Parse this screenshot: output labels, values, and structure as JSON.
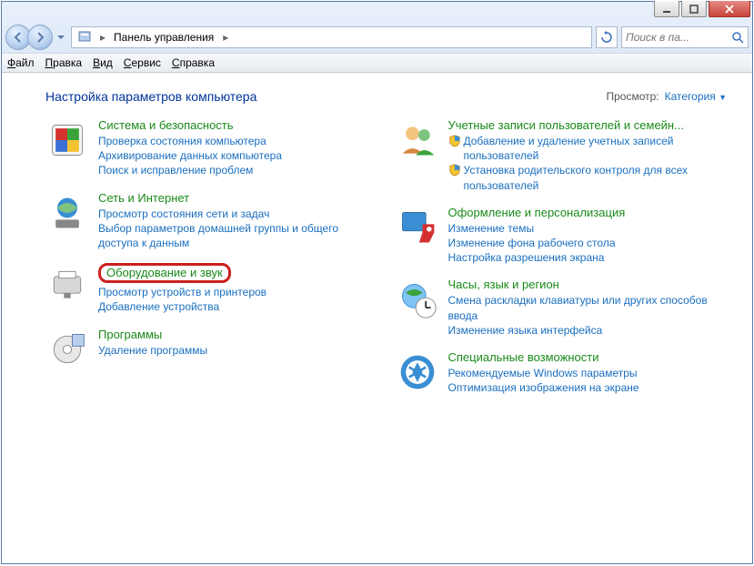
{
  "titlebar": {
    "min": "minimize",
    "max": "maximize",
    "close": "close"
  },
  "nav": {
    "back": "back",
    "forward": "forward"
  },
  "breadcrumb": {
    "root": "Панель управления"
  },
  "search": {
    "placeholder": "Поиск в па..."
  },
  "menu": {
    "file": "Файл",
    "edit": "Правка",
    "view": "Вид",
    "tools": "Сервис",
    "help": "Справка"
  },
  "header": {
    "title": "Настройка параметров компьютера",
    "view_label": "Просмотр:",
    "view_value": "Категория"
  },
  "categories": {
    "system": {
      "title": "Система и безопасность",
      "links": [
        "Проверка состояния компьютера",
        "Архивирование данных компьютера",
        "Поиск и исправление проблем"
      ]
    },
    "network": {
      "title": "Сеть и Интернет",
      "links": [
        "Просмотр состояния сети и задач",
        "Выбор параметров домашней группы и общего доступа к данным"
      ]
    },
    "hardware": {
      "title": "Оборудование и звук",
      "links": [
        "Просмотр устройств и принтеров",
        "Добавление устройства"
      ]
    },
    "programs": {
      "title": "Программы",
      "links": [
        "Удаление программы"
      ]
    },
    "users": {
      "title": "Учетные записи пользователей и семейн...",
      "links": [
        "Добавление и удаление учетных записей пользователей",
        "Установка родительского контроля для всех пользователей"
      ]
    },
    "appearance": {
      "title": "Оформление и персонализация",
      "links": [
        "Изменение темы",
        "Изменение фона рабочего стола",
        "Настройка разрешения экрана"
      ]
    },
    "clock": {
      "title": "Часы, язык и регион",
      "links": [
        "Смена раскладки клавиатуры или других способов ввода",
        "Изменение языка интерфейса"
      ]
    },
    "ease": {
      "title": "Специальные возможности",
      "links": [
        "Рекомендуемые Windows параметры",
        "Оптимизация изображения на экране"
      ]
    }
  }
}
